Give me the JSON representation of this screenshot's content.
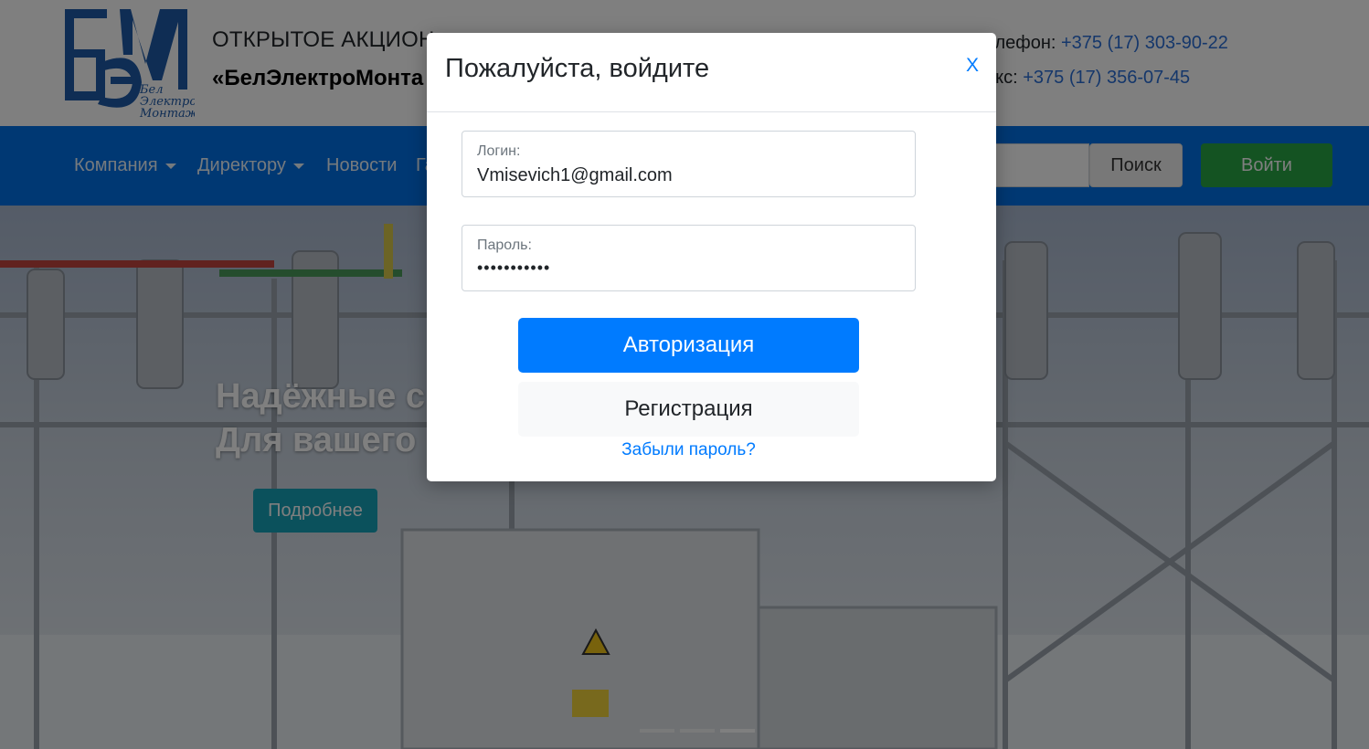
{
  "header": {
    "logo": {
      "letters": "БЭМ",
      "caption": [
        "Бел",
        "Электро",
        "Монтаж"
      ],
      "color": "#1e5aa8"
    },
    "company_line1": "ОТКРЫТОЕ АКЦИОН",
    "company_line2": "«БелЭлектроМонта",
    "phone_label": "елефон:",
    "phone_value": "+375 (17) 303-90-22",
    "fax_label": "акс:",
    "fax_value": "+375 (17) 356-07-45"
  },
  "navbar": {
    "color": "#0070e6",
    "items": [
      {
        "label": "Компания",
        "dropdown": true
      },
      {
        "label": "Директору",
        "dropdown": true
      },
      {
        "label": "Новости",
        "dropdown": false
      },
      {
        "label": "Га",
        "dropdown": false
      }
    ],
    "search_button": "Поиск",
    "login_button": "Войти"
  },
  "hero": {
    "title_line1": "Надёжные с",
    "title_line2": "Для вашего",
    "more_button": "Подробнее",
    "slides": [
      {
        "active": false
      },
      {
        "active": false
      },
      {
        "active": true
      }
    ]
  },
  "modal": {
    "title": "Пожалуйста, войдите",
    "close": "X",
    "login_label": "Логин:",
    "login_value": "Vmisevich1@gmail.com",
    "password_label": "Пароль:",
    "password_value": "•••••••••••",
    "auth_button": "Авторизация",
    "register_button": "Регистрация",
    "forgot_link": "Забыли пароль?"
  },
  "colors": {
    "primary": "#007bff",
    "success": "#28a745",
    "info": "#17a2b8",
    "link": "#2a6fd6"
  }
}
